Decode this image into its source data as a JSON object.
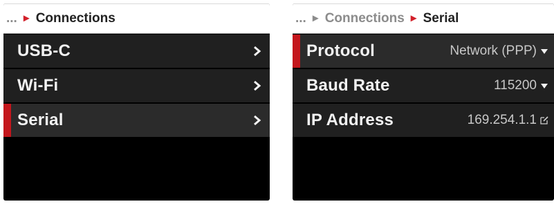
{
  "left_panel": {
    "breadcrumb": {
      "ellipsis": "...",
      "current": "Connections"
    },
    "items": [
      {
        "label": "USB-C",
        "icon": "chevron-right-icon",
        "selected": false
      },
      {
        "label": "Wi-Fi",
        "icon": "chevron-right-icon",
        "selected": false
      },
      {
        "label": "Serial",
        "icon": "chevron-right-icon",
        "selected": true
      }
    ]
  },
  "right_panel": {
    "breadcrumb": {
      "ellipsis": "...",
      "parent": "Connections",
      "current": "Serial"
    },
    "settings": [
      {
        "label": "Protocol",
        "value": "Network (PPP)",
        "icon": "dropdown-arrow-icon",
        "selected": true
      },
      {
        "label": "Baud Rate",
        "value": "115200",
        "icon": "dropdown-arrow-icon",
        "selected": false
      },
      {
        "label": "IP Address",
        "value": "169.254.1.1",
        "icon": "edit-icon",
        "selected": false
      }
    ]
  },
  "colors": {
    "accent": "#c4161c",
    "row_bg": "#202020",
    "screen_bg": "#000000",
    "titlebar_bg": "#ffffff"
  }
}
